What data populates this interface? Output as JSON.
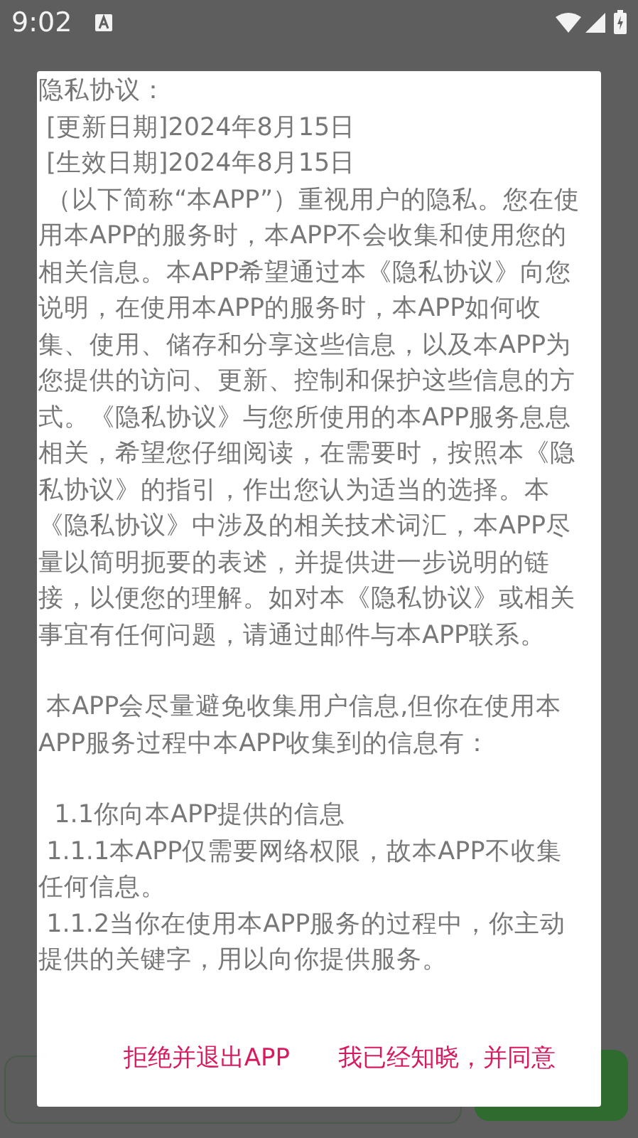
{
  "status_bar": {
    "time": "9:02"
  },
  "dialog": {
    "paragraphs": [
      "隐私协议：",
      " [更新日期]2024年8月15日",
      " [生效日期]2024年8月15日",
      " （以下简称“本APP”）重视用户的隐私。您在使用本APP的服务时，本APP不会收集和使用您的相关信息。本APP希望通过本《隐私协议》向您说明，在使用本APP的服务时，本APP如何收集、使用、储存和分享这些信息，以及本APP为您提供的访问、更新、控制和保护这些信息的方式。《隐私协议》与您所使用的本APP服务息息相关，希望您仔细阅读，在需要时，按照本《隐私协议》的指引，作出您认为适当的选择。本《隐私协议》中涉及的相关技术词汇，本APP尽量以简明扼要的表述，并提供进一步说明的链接，以便您的理解。如对本《隐私协议》或相关事宜有任何问题，请通过邮件与本APP联系。",
      " 本APP会尽量避免收集用户信息,但你在使用本APP服务过程中本APP收集到的信息有：",
      "  1.1你向本APP提供的信息",
      " 1.1.1本APP仅需要网络权限，故本APP不收集任何信息。",
      " 1.1.2当你在使用本APP服务的过程中，你主动提供的关键字，用以向你提供服务。"
    ],
    "buttons": [
      "拒绝并退出APP",
      "我已经知晓，并同意"
    ]
  }
}
